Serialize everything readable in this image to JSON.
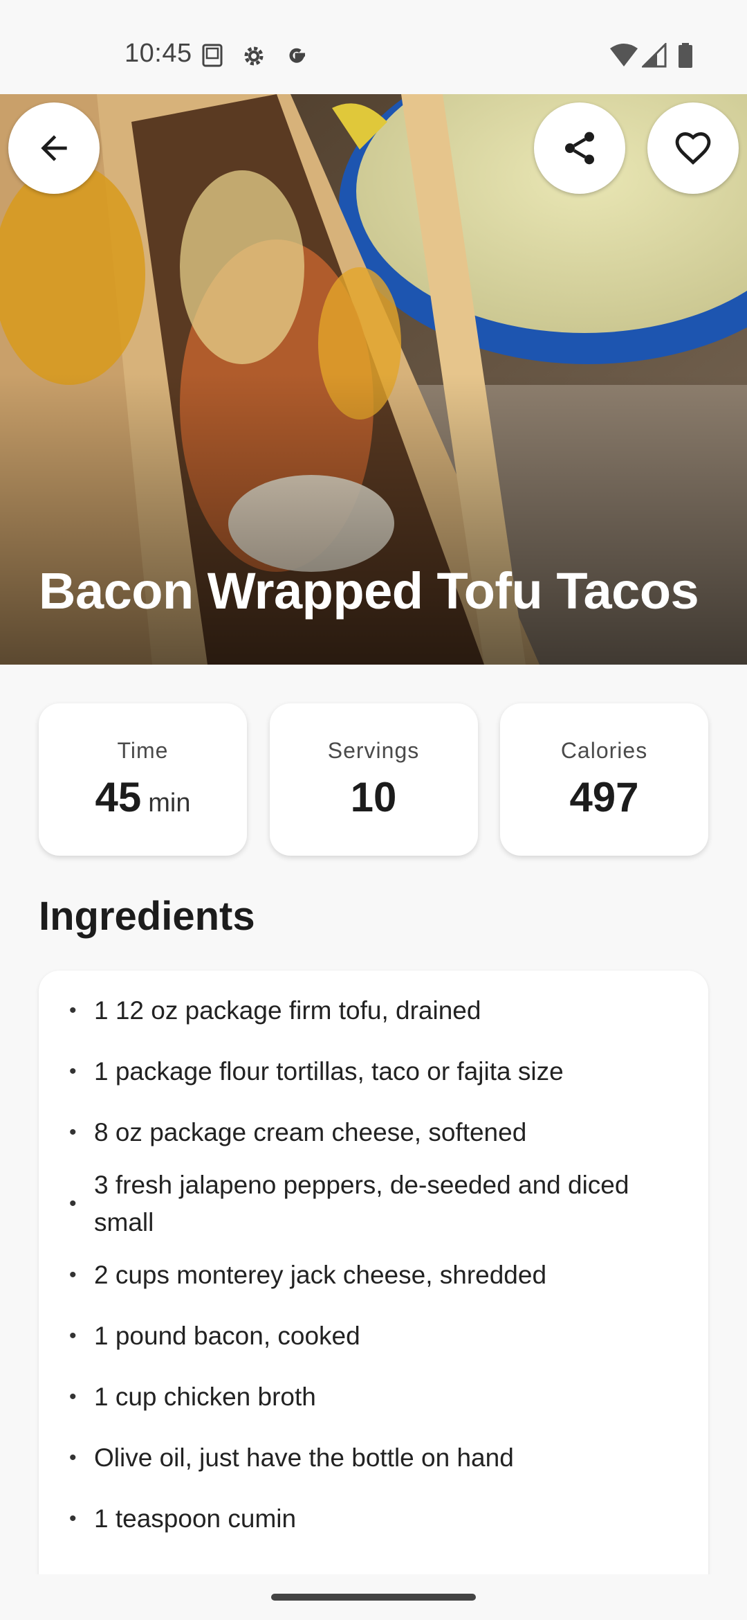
{
  "status_bar": {
    "time": "10:45",
    "icons": [
      "sim-card-icon",
      "settings-gear-icon",
      "google-g-icon",
      "wifi-icon",
      "signal-icon",
      "battery-icon"
    ]
  },
  "hero": {
    "title": "Bacon Wrapped Tofu Tacos",
    "image": "taco-photo"
  },
  "actions": {
    "back": "back-arrow-icon",
    "share": "share-icon",
    "favorite": "heart-outline-icon"
  },
  "stats": {
    "time": {
      "label": "Time",
      "value": "45",
      "unit": "min"
    },
    "servings": {
      "label": "Servings",
      "value": "10"
    },
    "calories": {
      "label": "Calories",
      "value": "497"
    }
  },
  "ingredients": {
    "title": "Ingredients",
    "items": [
      "1 12 oz package firm tofu, drained",
      "1 package flour tortillas, taco or fajita size",
      "8 oz package cream cheese, softened",
      "3 fresh jalapeno peppers, de-seeded and diced small",
      "2 cups monterey jack cheese, shredded",
      "1 pound bacon, cooked",
      "1 cup chicken broth",
      "Olive oil, just have the bottle on hand",
      "1 teaspoon cumin"
    ]
  },
  "colors": {
    "background": "#f8f8f8",
    "card": "#ffffff",
    "text": "#1c1c1c",
    "hero_title": "#ffffff"
  }
}
